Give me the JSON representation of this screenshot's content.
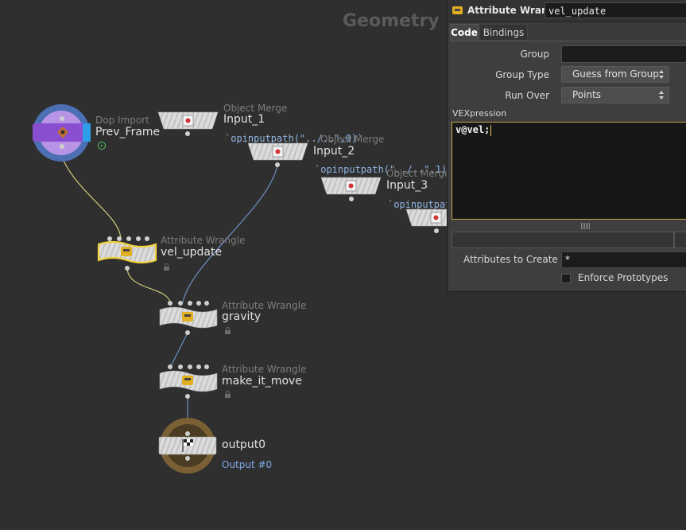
{
  "network": {
    "context_label": "Geometry",
    "nodes": [
      {
        "id": "prev_frame",
        "type_label": "Dop Import",
        "name": "Prev_Frame"
      },
      {
        "id": "input_1",
        "type_label": "Object Merge",
        "name": "Input_1",
        "expr": "`opinputpath(\"../..\",0)`"
      },
      {
        "id": "input_2",
        "type_label": "Object Merge",
        "name": "Input_2",
        "expr": "`opinputpath(\"../..\",1)`"
      },
      {
        "id": "input_3",
        "type_label": "Object Merge",
        "name": "Input_3",
        "expr": "`opinputpath"
      },
      {
        "id": "vel_update",
        "type_label": "Attribute Wrangle",
        "name": "vel_update"
      },
      {
        "id": "gravity",
        "type_label": "Attribute Wrangle",
        "name": "gravity"
      },
      {
        "id": "make_it_move",
        "type_label": "Attribute Wrangle",
        "name": "make_it_move"
      },
      {
        "id": "output0",
        "name": "output0",
        "sublabel": "Output #0"
      }
    ]
  },
  "panel": {
    "node_type": "Attribute Wrangle",
    "node_name": "vel_update",
    "tabs": [
      {
        "label": "Code",
        "active": true
      },
      {
        "label": "Bindings",
        "active": false
      }
    ],
    "group": {
      "label": "Group",
      "value": ""
    },
    "group_type": {
      "label": "Group Type",
      "value": "Guess from Group"
    },
    "run_over": {
      "label": "Run Over",
      "value": "Points"
    },
    "vexpression": {
      "label": "VEXpression",
      "code": "v@vel;"
    },
    "attributes_to_create": {
      "label": "Attributes to Create",
      "value": "*"
    },
    "enforce_prototypes": {
      "label": "Enforce Prototypes",
      "checked": false
    }
  },
  "colors": {
    "background": "#2f2f2f",
    "selected_outline": "#f0d23c",
    "wire": "#6d8fc2",
    "wire_selected": "#cfca7a",
    "dop_import": "#8a4fd0",
    "output_ring": "#7a6034"
  },
  "icons": {
    "dop_import": "dop-import-icon",
    "object_merge": "object-merge-icon",
    "wrangle": "wrangle-icon",
    "output": "checkered-flag-icon",
    "lock": "lock-icon"
  }
}
